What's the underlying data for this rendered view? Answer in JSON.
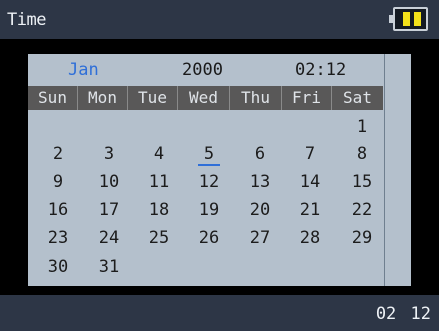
{
  "titlebar": {
    "title": "Time",
    "battery_color": "#f3e11a",
    "battery_levels": 2,
    "battery_icon": "battery-icon"
  },
  "calendar": {
    "month": "Jan",
    "year": "2000",
    "time": "02:12",
    "weekdays": [
      "Sun",
      "Mon",
      "Tue",
      "Wed",
      "Thu",
      "Fri",
      "Sat"
    ],
    "selected_day": "5",
    "weeks": [
      [
        "",
        "",
        "",
        "",
        "",
        "",
        "1"
      ],
      [
        "2",
        "3",
        "4",
        "5",
        "6",
        "7",
        "8"
      ],
      [
        "9",
        "10",
        "11",
        "12",
        "13",
        "14",
        "15"
      ],
      [
        "16",
        "17",
        "18",
        "19",
        "20",
        "21",
        "22"
      ],
      [
        "23",
        "24",
        "25",
        "26",
        "27",
        "28",
        "29"
      ],
      [
        "30",
        "31",
        "",
        "",
        "",
        "",
        ""
      ]
    ]
  },
  "statusbar": {
    "clock": "02 12"
  },
  "colors": {
    "accent": "#2f6fd8",
    "bar_bg": "#2d3646",
    "panel_bg": "#b4c0cc",
    "weekday_header_bg": "#595858"
  }
}
